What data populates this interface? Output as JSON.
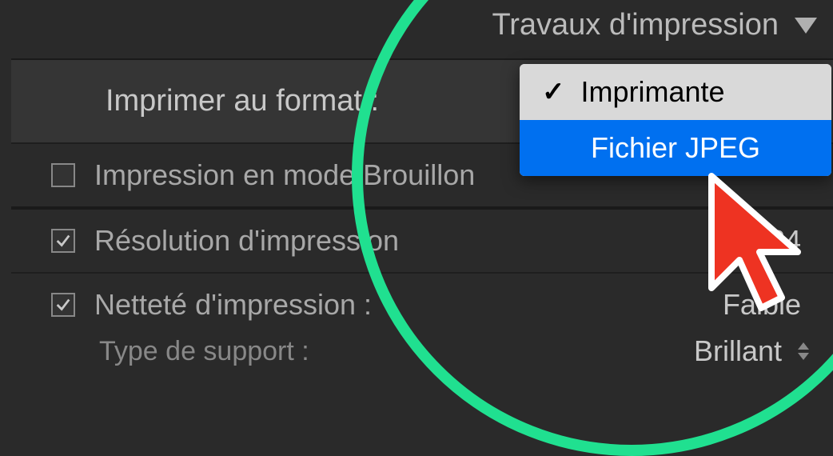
{
  "panel": {
    "title": "Travaux d'impression"
  },
  "rows": {
    "format_label": "Imprimer au format :",
    "draft_mode": {
      "label": "Impression en mode Brouillon",
      "checked": false
    },
    "resolution": {
      "label": "Résolution d'impression",
      "checked": true,
      "value": "24"
    },
    "sharpening": {
      "label": "Netteté d'impression :",
      "checked": true,
      "value": "Faible"
    },
    "media_type": {
      "label": "Type de support :",
      "value": "Brillant"
    }
  },
  "dropdown": {
    "items": [
      {
        "label": "Imprimante",
        "selected": true
      },
      {
        "label": "Fichier JPEG",
        "highlighted": true
      }
    ]
  }
}
